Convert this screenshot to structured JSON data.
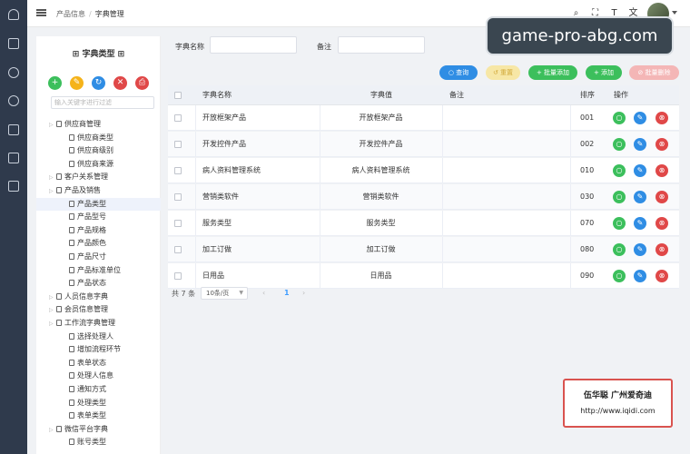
{
  "topbar": {
    "breadcrumbs": [
      "产品信息",
      "字典管理"
    ],
    "icons": [
      "search-icon",
      "fullscreen-icon",
      "font-size-icon",
      "language-icon",
      "avatar"
    ]
  },
  "banner": {
    "text": "game-pro-abg.com"
  },
  "tree": {
    "title": "字典类型",
    "buttons": [
      {
        "name": "add",
        "icon": "+",
        "color": "#3cbf5c"
      },
      {
        "name": "edit",
        "icon": "✎",
        "color": "#f5b31a"
      },
      {
        "name": "refresh",
        "icon": "↻",
        "color": "#2f8de4"
      },
      {
        "name": "delete",
        "icon": "✕",
        "color": "#e04848"
      },
      {
        "name": "export",
        "icon": "⎙",
        "color": "#e04848"
      }
    ],
    "search_placeholder": "输入关键字进行过滤",
    "nodes": [
      {
        "label": "供应商管理",
        "level": 0
      },
      {
        "label": "供应商类型",
        "level": 1
      },
      {
        "label": "供应商级别",
        "level": 1
      },
      {
        "label": "供应商来源",
        "level": 1
      },
      {
        "label": "客户关系管理",
        "level": 0
      },
      {
        "label": "产品及销售",
        "level": 0
      },
      {
        "label": "产品类型",
        "level": 1,
        "selected": true
      },
      {
        "label": "产品型号",
        "level": 1
      },
      {
        "label": "产品规格",
        "level": 1
      },
      {
        "label": "产品颜色",
        "level": 1
      },
      {
        "label": "产品尺寸",
        "level": 1
      },
      {
        "label": "产品标准单位",
        "level": 1
      },
      {
        "label": "产品状态",
        "level": 1
      },
      {
        "label": "人员信息字典",
        "level": 0
      },
      {
        "label": "会员信息管理",
        "level": 0
      },
      {
        "label": "工作流字典管理",
        "level": 0
      },
      {
        "label": "选择处理人",
        "level": 1
      },
      {
        "label": "增加流程环节",
        "level": 1
      },
      {
        "label": "表单状态",
        "level": 1
      },
      {
        "label": "处理人信息",
        "level": 1
      },
      {
        "label": "通知方式",
        "level": 1
      },
      {
        "label": "处理类型",
        "level": 1
      },
      {
        "label": "表单类型",
        "level": 1
      },
      {
        "label": "微信平台字典",
        "level": 0
      },
      {
        "label": "账号类型",
        "level": 1
      }
    ]
  },
  "filters": {
    "name_label": "字典名称",
    "note_label": "备注"
  },
  "toolbar": {
    "buttons": [
      {
        "label": "查询",
        "icon": "○",
        "color": "#2f8de4"
      },
      {
        "label": "重置",
        "icon": "↺",
        "color": "#f7e7a6",
        "text_color": "#d2a93a"
      },
      {
        "label": "批量添加",
        "icon": "+",
        "color": "#3cbf5c"
      },
      {
        "label": "添加",
        "icon": "+",
        "color": "#3cbf5c"
      },
      {
        "label": "批量删除",
        "icon": "⊘",
        "color": "#f4b6b6",
        "text_color": "#fff"
      }
    ]
  },
  "table": {
    "headers": [
      "字典名称",
      "字典值",
      "备注",
      "排序",
      "操作"
    ],
    "rows": [
      {
        "name": "开放框架产品",
        "value": "开放框架产品",
        "note": "",
        "sort": "001"
      },
      {
        "name": "开发控件产品",
        "value": "开发控件产品",
        "note": "",
        "sort": "002"
      },
      {
        "name": "病人资料管理系统",
        "value": "病人资料管理系统",
        "note": "",
        "sort": "010"
      },
      {
        "name": "营销类软件",
        "value": "营销类软件",
        "note": "",
        "sort": "030"
      },
      {
        "name": "服务类型",
        "value": "服务类型",
        "note": "",
        "sort": "070"
      },
      {
        "name": "加工订做",
        "value": "加工订做",
        "note": "",
        "sort": "080"
      },
      {
        "name": "日用品",
        "value": "日用品",
        "note": "",
        "sort": "090"
      }
    ],
    "action_colors": {
      "view": "#3cbf5c",
      "edit": "#2f8de4",
      "delete": "#e04848"
    }
  },
  "pagination": {
    "total": "共 7 条",
    "page_size": "10条/页",
    "current_page": "1"
  },
  "credit": {
    "name": "伍华聪 广州爱奇迪",
    "url": "http://www.iqidi.com"
  }
}
